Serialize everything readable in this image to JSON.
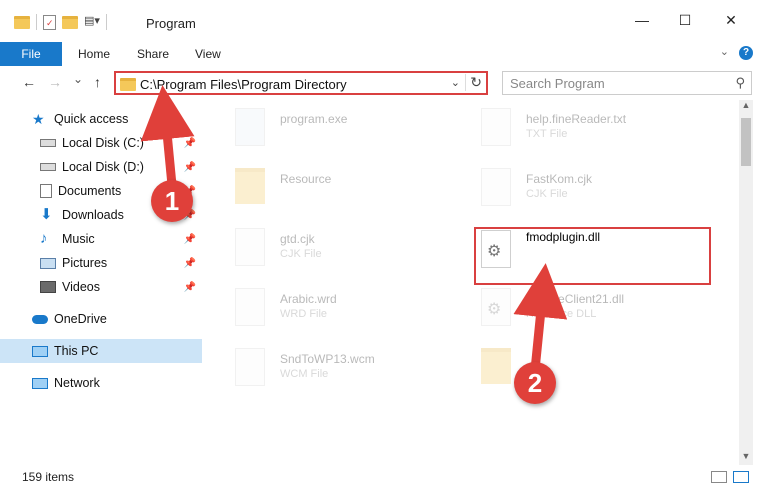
{
  "window": {
    "title": "Program",
    "minimize": "—",
    "maximize": "☐",
    "close": "✕"
  },
  "ribbon": {
    "tabs": [
      "File",
      "Home",
      "Share",
      "View"
    ],
    "help": "?"
  },
  "navigation": {
    "back": "←",
    "forward": "→",
    "recent": "⌄",
    "up": "↑",
    "address": "C:\\Program Files\\Program Directory",
    "search_placeholder": "Search Program"
  },
  "sidebar": {
    "items": [
      {
        "label": "Quick access",
        "icon": "star-icon"
      },
      {
        "label": "Local Disk (C:)",
        "icon": "drive-icon",
        "pinned": true
      },
      {
        "label": "Local Disk (D:)",
        "icon": "drive-icon",
        "pinned": true
      },
      {
        "label": "Documents",
        "icon": "documents-icon",
        "pinned": true
      },
      {
        "label": "Downloads",
        "icon": "download-icon",
        "pinned": true
      },
      {
        "label": "Music",
        "icon": "music-icon",
        "pinned": true
      },
      {
        "label": "Pictures",
        "icon": "pictures-icon",
        "pinned": true
      },
      {
        "label": "Videos",
        "icon": "videos-icon",
        "pinned": true
      },
      {
        "label": "OneDrive",
        "icon": "cloud-icon"
      },
      {
        "label": "This PC",
        "icon": "pc-icon",
        "selected": true
      },
      {
        "label": "Network",
        "icon": "network-icon"
      }
    ]
  },
  "files": [
    {
      "name": "program.exe",
      "type": "",
      "kind": "exe",
      "faded": true
    },
    {
      "name": "help.fineReader.txt",
      "type": "TXT File",
      "kind": "doc",
      "faded": true
    },
    {
      "name": "Resource",
      "type": "",
      "kind": "folder",
      "faded": true
    },
    {
      "name": "FastKom.cjk",
      "type": "CJK File",
      "kind": "doc",
      "faded": true
    },
    {
      "name": "gtd.cjk",
      "type": "CJK File",
      "kind": "doc",
      "faded": true
    },
    {
      "name": "fmodplugin.dll",
      "type": "",
      "kind": "dll",
      "faded": false
    },
    {
      "name": "Arabic.wrd",
      "type": "WRD File",
      "kind": "doc",
      "faded": true
    },
    {
      "name": "UpdateClient21.dll",
      "type": "Resource DLL",
      "kind": "dll",
      "faded": true
    },
    {
      "name": "SndToWP13.wcm",
      "type": "WCM File",
      "kind": "doc",
      "faded": true
    },
    {
      "name": "",
      "type": "",
      "kind": "folder",
      "faded": true
    }
  ],
  "status": {
    "count": "159 items"
  },
  "callouts": [
    "1",
    "2"
  ],
  "colors": {
    "accent": "#1979ca",
    "highlight": "#d94040",
    "selected": "#cce4f7",
    "folder": "#f4c85a"
  }
}
